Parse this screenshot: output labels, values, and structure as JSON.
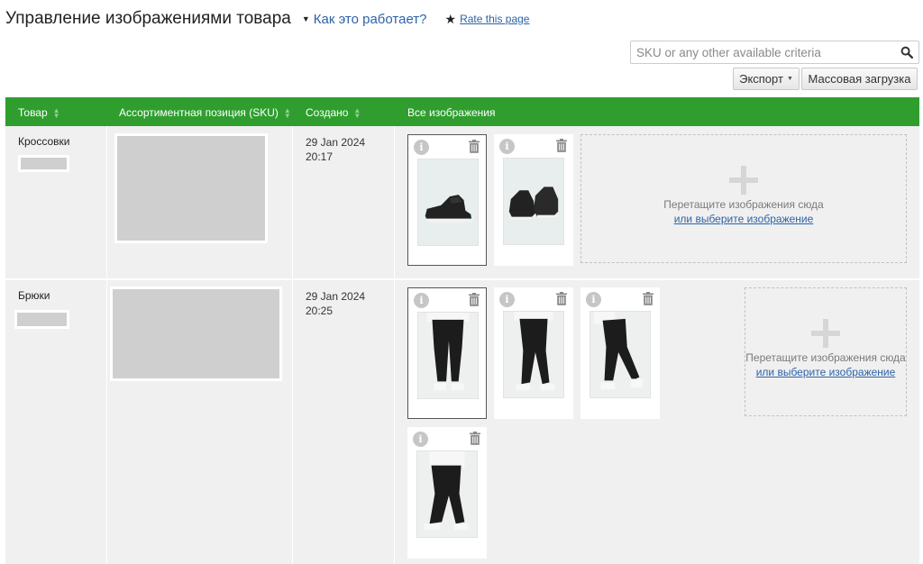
{
  "header": {
    "title": "Управление изображениями товара",
    "how_link": "Как это работает?",
    "rate_link": "Rate this page"
  },
  "search": {
    "placeholder": "SKU or any other available criteria",
    "value": ""
  },
  "toolbar": {
    "export_label": "Экспорт",
    "bulk_upload_label": "Массовая загрузка"
  },
  "table": {
    "headers": [
      "Товар",
      "Ассортиментная позиция (SKU)",
      "Создано",
      "Все изображения"
    ],
    "accent_color": "#2f9e2f",
    "rows": [
      {
        "product": "Кроссовки",
        "date": "29 Jan 2024",
        "time": "20:17",
        "images": [
          "sneaker-side",
          "sneaker-pair"
        ],
        "drop_text": "Перетащите изображения сюда",
        "drop_link": "или выберите изображение"
      },
      {
        "product": "Брюки",
        "date": "29 Jan 2024",
        "time": "20:25",
        "images": [
          "pants-front",
          "pants-side",
          "pants-profile",
          "pants-back"
        ],
        "drop_text": "Перетащите изображения сюда",
        "drop_link": "или выберите изображение"
      }
    ]
  },
  "icons": {
    "info": "i"
  }
}
